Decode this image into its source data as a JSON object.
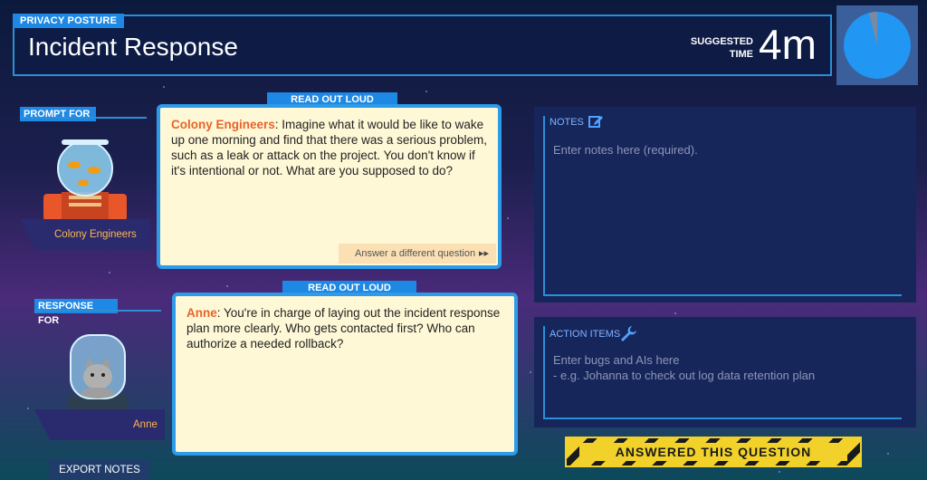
{
  "header": {
    "section_tag": "PRIVACY POSTURE",
    "title": "Incident Response",
    "suggested_label_1": "SUGGESTED",
    "suggested_label_2": "TIME",
    "suggested_time": "4m",
    "timer_elapsed_fraction": 0.04
  },
  "prompt": {
    "side_tag": "PROMPT FOR",
    "ribbon": "READ OUT LOUD",
    "speaker": "Colony Engineers",
    "text": ": Imagine what it would be like to wake up one morning and find that there was a serious problem, such as a leak or attack on the project. You don't know if it's intentional or not. What are you supposed to do?",
    "alt_button": "Answer a different question",
    "avatar_name": "Colony Engineers"
  },
  "response": {
    "side_tag": "RESPONSE FOR",
    "ribbon": "READ OUT LOUD",
    "speaker": "Anne",
    "text": ": You're in charge of laying out the incident response plan more clearly. Who gets contacted first? Who can authorize a needed rollback?",
    "avatar_name": "Anne"
  },
  "notes": {
    "label": "NOTES",
    "placeholder": "Enter notes here (required)."
  },
  "action_items": {
    "label": "ACTION ITEMS",
    "placeholder_line_1": "Enter bugs and AIs here",
    "placeholder_line_2": "- e.g. Johanna to check out log data retention plan"
  },
  "answered_button": "ANSWERED THIS QUESTION",
  "export_button": "EXPORT NOTES",
  "colors": {
    "accent_blue": "#1e88e5",
    "card_bg": "#fff8d6",
    "speaker_orange": "#e8632b",
    "hazard_yellow": "#f2d22a"
  }
}
